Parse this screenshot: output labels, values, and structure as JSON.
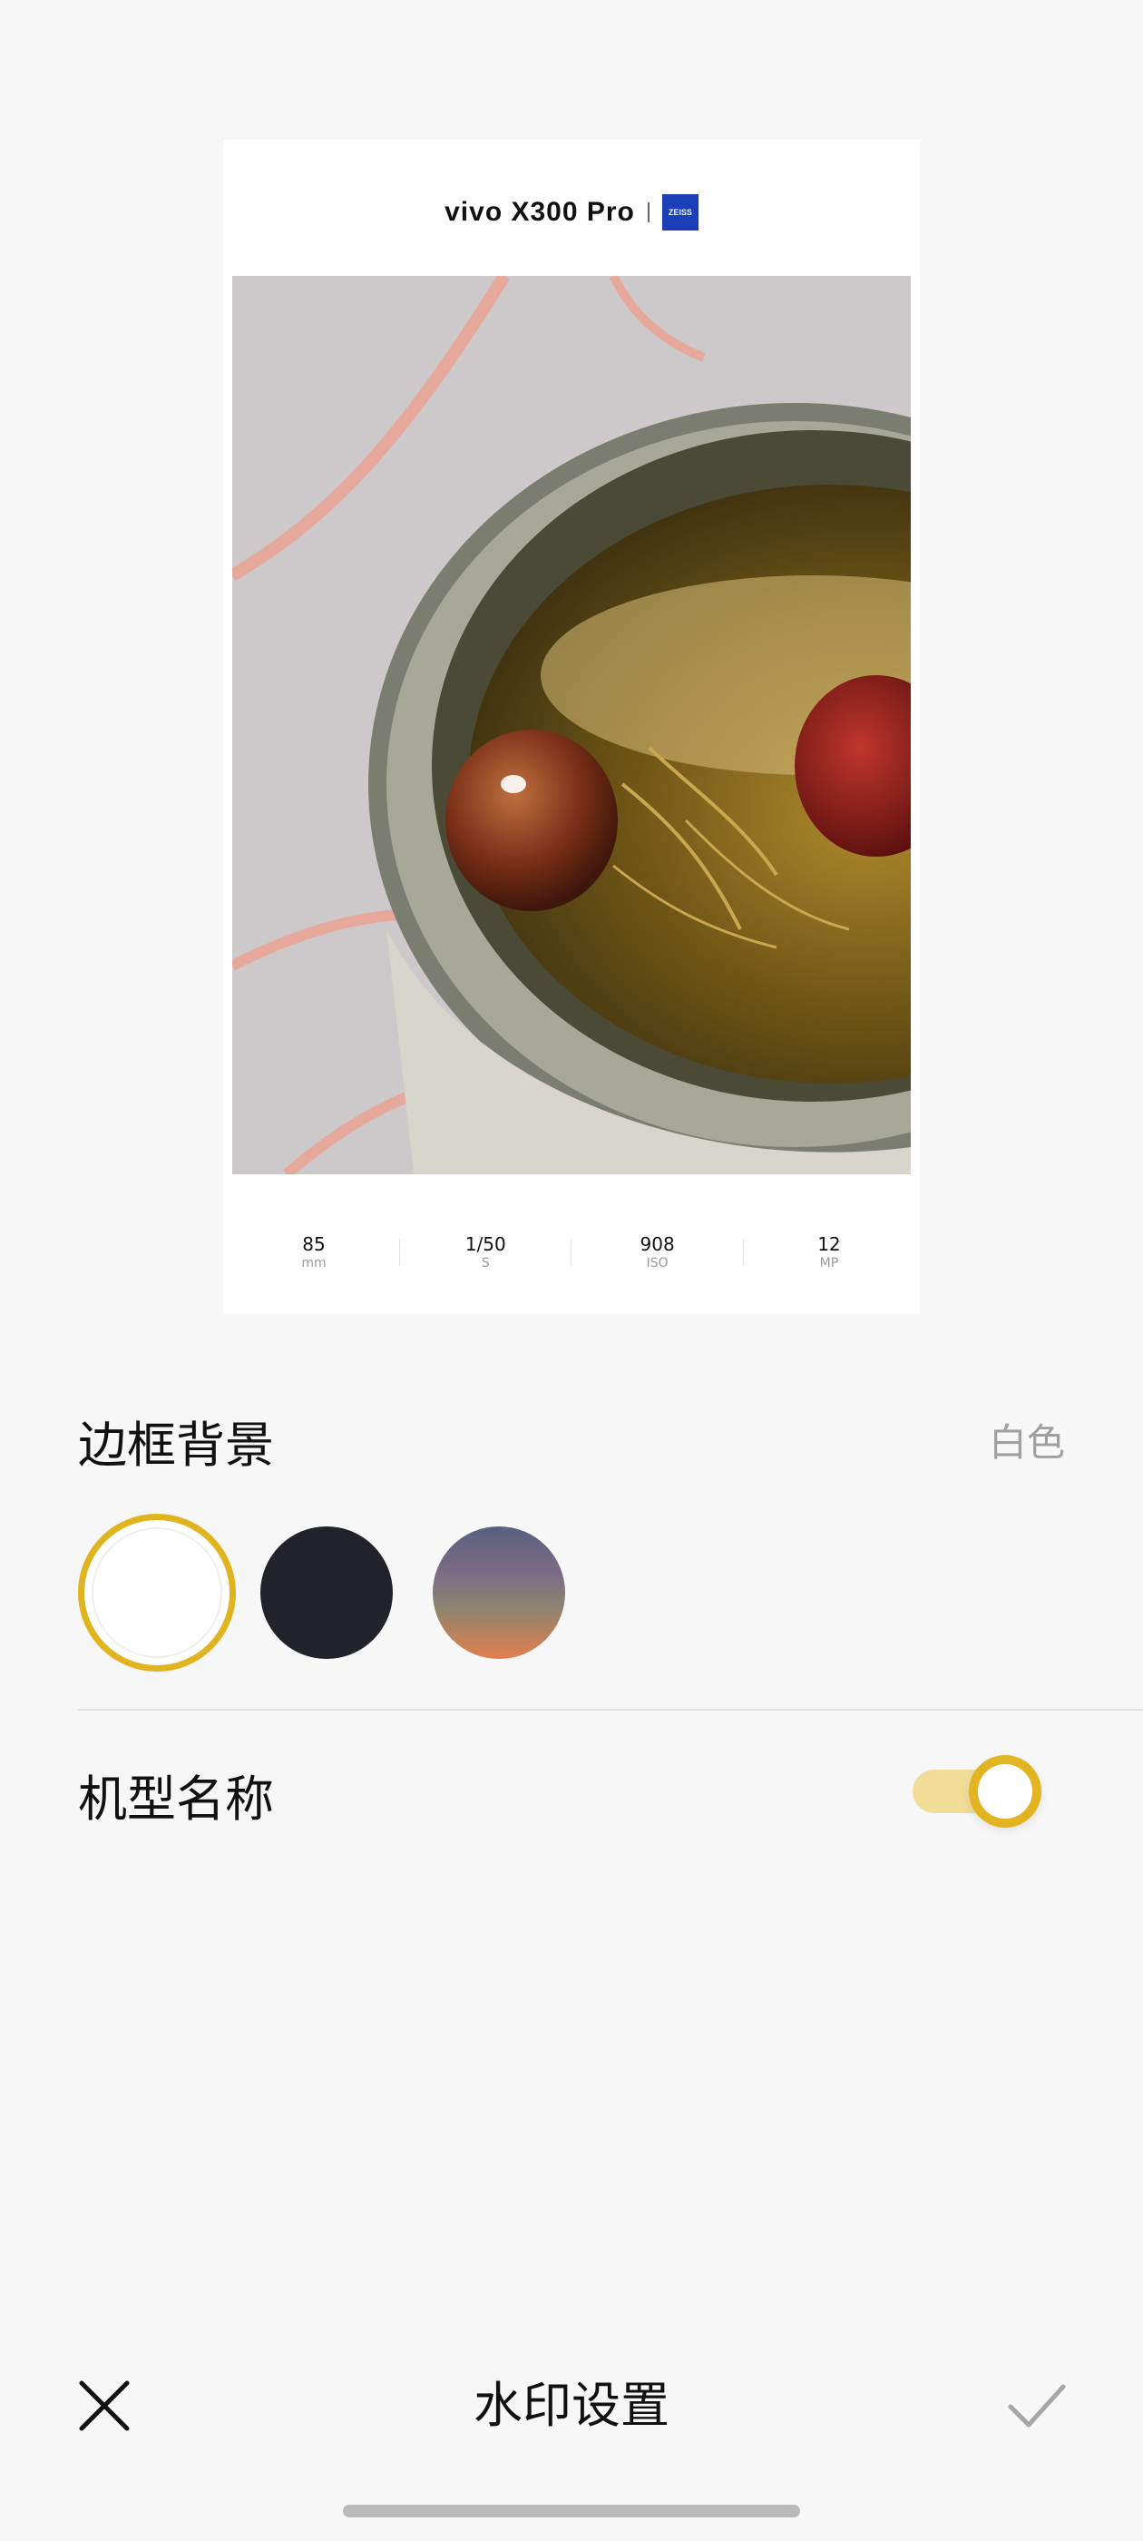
{
  "preview": {
    "brand_name": "vivo X300 Pro",
    "brand_logo": "ZEISS",
    "exif": [
      {
        "value": "85",
        "unit": "mm"
      },
      {
        "value": "1/50",
        "unit": "S"
      },
      {
        "value": "908",
        "unit": "ISO"
      },
      {
        "value": "12",
        "unit": "MP"
      }
    ]
  },
  "frame_background": {
    "label": "边框背景",
    "selected_value": "白色",
    "swatches": [
      {
        "name": "white",
        "color": "#ffffff",
        "selected": true
      },
      {
        "name": "black",
        "color": "#22222a",
        "selected": false
      },
      {
        "name": "gradient",
        "colors": [
          "#5b5f7f",
          "#e0804e"
        ],
        "selected": false
      }
    ]
  },
  "model_name": {
    "label": "机型名称",
    "enabled": true
  },
  "bottom_bar": {
    "title": "水印设置",
    "close_icon": "close-icon",
    "confirm_icon": "check-icon"
  },
  "accent_color": "#e2b421"
}
